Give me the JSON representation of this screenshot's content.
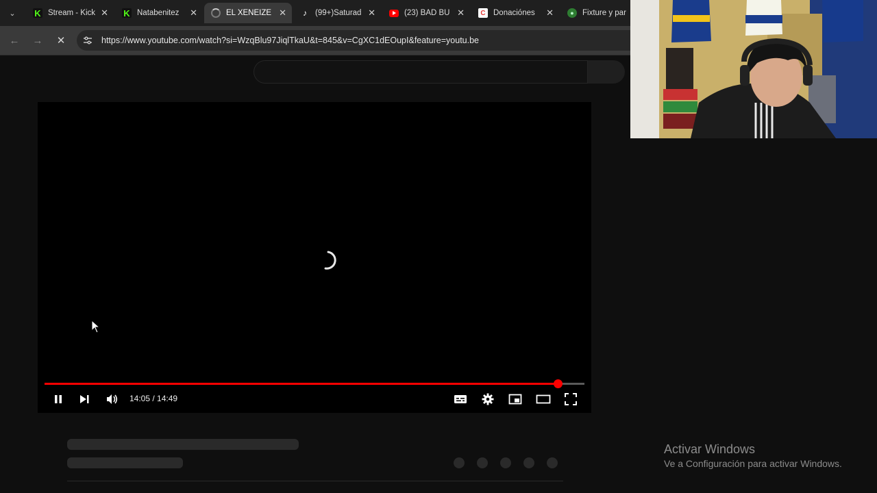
{
  "browser": {
    "tabs": [
      {
        "title": "Stream - Kick",
        "favicon": "kick-icon",
        "active": false
      },
      {
        "title": "Natabenitez",
        "favicon": "kick-icon",
        "active": false
      },
      {
        "title": "EL XENEIZE",
        "favicon": "loading-spinner-icon",
        "active": true
      },
      {
        "title": "(99+)Saturad",
        "favicon": "tiktok-icon",
        "active": false
      },
      {
        "title": "(23) BAD BU",
        "favicon": "youtube-icon",
        "active": false
      },
      {
        "title": "Donaciónes",
        "favicon": "c-icon",
        "active": false
      },
      {
        "title": "Fixture y par",
        "favicon": "globe-icon",
        "active": false
      }
    ],
    "url": "https://www.youtube.com/watch?si=WzqBlu97JiqlTkaU&t=845&v=CgXC1dEOupI&feature=youtu.be"
  },
  "player": {
    "time_display": "14:05 / 14:49",
    "progress_fraction": 0.951,
    "state": "loading",
    "accent_color": "#ff0000"
  },
  "watermark": {
    "title": "Activar Windows",
    "subtitle": "Ve a Configuración para activar Windows."
  }
}
